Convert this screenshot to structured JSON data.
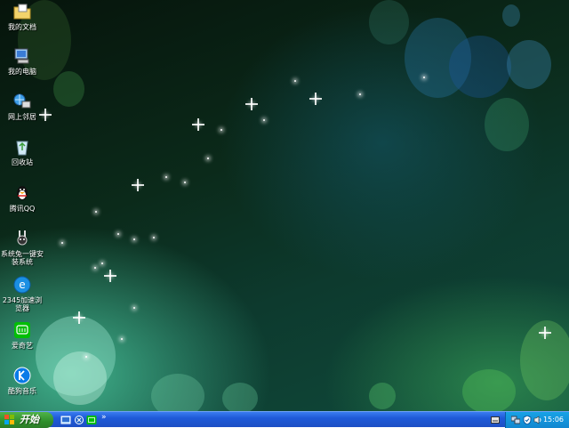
{
  "desktop_icons": [
    {
      "id": "my-documents",
      "label": "我的文档"
    },
    {
      "id": "my-computer",
      "label": "我的电脑"
    },
    {
      "id": "network",
      "label": "网上邻居"
    },
    {
      "id": "recycle-bin",
      "label": "回收站"
    },
    {
      "id": "qq",
      "label": "腾讯QQ"
    },
    {
      "id": "one-click-install",
      "label": "系统兔一键安装系统"
    },
    {
      "id": "browser-2345",
      "label": "2345加速浏览器"
    },
    {
      "id": "iqiyi",
      "label": "爱奇艺"
    },
    {
      "id": "kugou",
      "label": "酷狗音乐"
    }
  ],
  "taskbar": {
    "start_label": "开始",
    "quicklaunch_more": "»",
    "clock": "15:06"
  },
  "colors": {
    "taskbar_blue": "#1f5ad8",
    "start_green": "#2f8f2b",
    "tray_blue": "#1287d0"
  }
}
